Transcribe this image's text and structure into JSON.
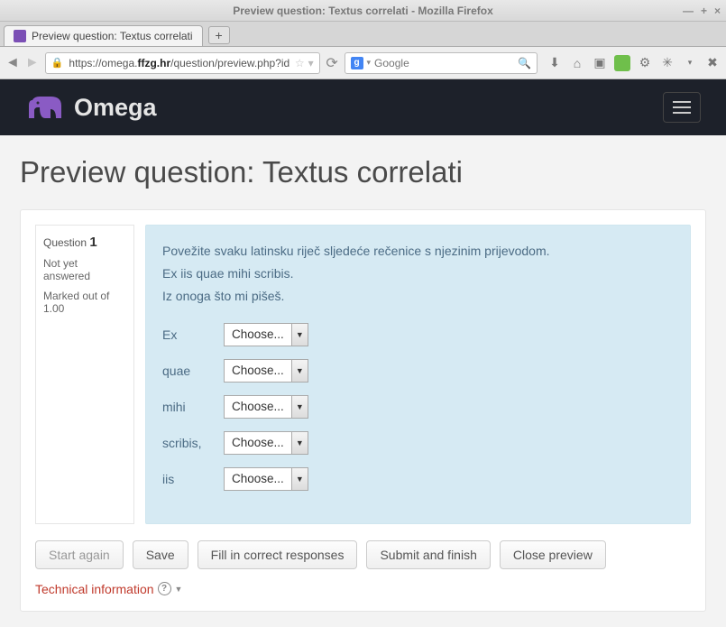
{
  "window": {
    "title": "Preview question: Textus correlati - Mozilla Firefox",
    "min": "—",
    "max": "+",
    "close": "×"
  },
  "browser": {
    "tab_title": "Preview question: Textus correlati",
    "new_tab": "+",
    "url_scheme": "https://",
    "url_sub": "omega.",
    "url_host_bold": "ffzg.hr",
    "url_path": "/question/preview.php?id=",
    "search_placeholder": "Google"
  },
  "site": {
    "brand": "Omega"
  },
  "page": {
    "title": "Preview question: Textus correlati"
  },
  "question": {
    "label": "Question",
    "number": "1",
    "status": "Not yet answered",
    "marked": "Marked out of 1.00",
    "prompt_1": "Povežite svaku latinsku riječ sljedeće rečenice s njezinim prijevodom.",
    "prompt_2": "Ex iis quae mihi scribis.",
    "prompt_3": "Iz onoga što mi pišeš.",
    "choose_label": "Choose...",
    "items": [
      {
        "word": "Ex"
      },
      {
        "word": "quae"
      },
      {
        "word": "mihi"
      },
      {
        "word": "scribis,"
      },
      {
        "word": "iis"
      }
    ]
  },
  "actions": {
    "start_again": "Start again",
    "save": "Save",
    "fill": "Fill in correct responses",
    "submit": "Submit and finish",
    "close": "Close preview"
  },
  "footer": {
    "tech_info": "Technical information"
  }
}
